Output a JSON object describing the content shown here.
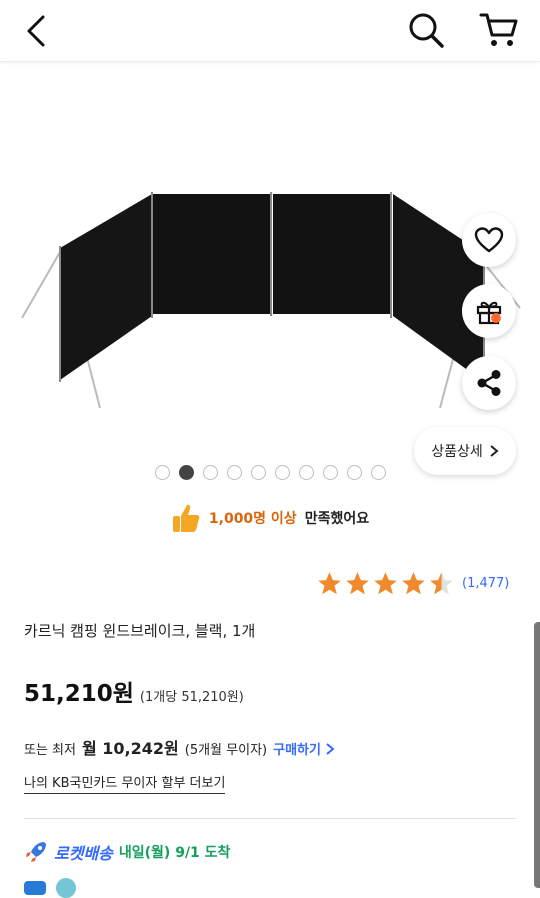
{
  "header": {
    "back_icon": "chevron-left-icon",
    "search_icon": "search-icon",
    "cart_icon": "cart-icon"
  },
  "floating_actions": {
    "heart_icon": "heart-icon",
    "gift_icon": "gift-icon",
    "share_icon": "share-icon"
  },
  "gallery": {
    "detail_button_label": "상품상세",
    "dots_total": 10,
    "dots_active_index": 1
  },
  "satisfaction": {
    "highlight": "1,000명 이상",
    "text": "만족했어요"
  },
  "rating": {
    "stars": 4.5,
    "review_count": "(1,477)"
  },
  "product": {
    "title": "카르닉 캠핑 윈드브레이크, 블랙, 1개",
    "price": "51,210원",
    "unit_price": "(1개당 51,210원)"
  },
  "installment": {
    "prefix": "또는 최저",
    "amount": "월 10,242원",
    "detail": "(5개월 무이자)",
    "buy_label": "구매하기"
  },
  "card_promo": "나의 KB국민카드 무이자 할부 더보기",
  "delivery": {
    "rocket_label": "로켓배송",
    "eta": "내일(월) 9/1 도착"
  },
  "colors": {
    "accent_blue": "#346aff",
    "orange": "#d9650a",
    "green": "#13a05c",
    "star": "#f08a2c"
  }
}
